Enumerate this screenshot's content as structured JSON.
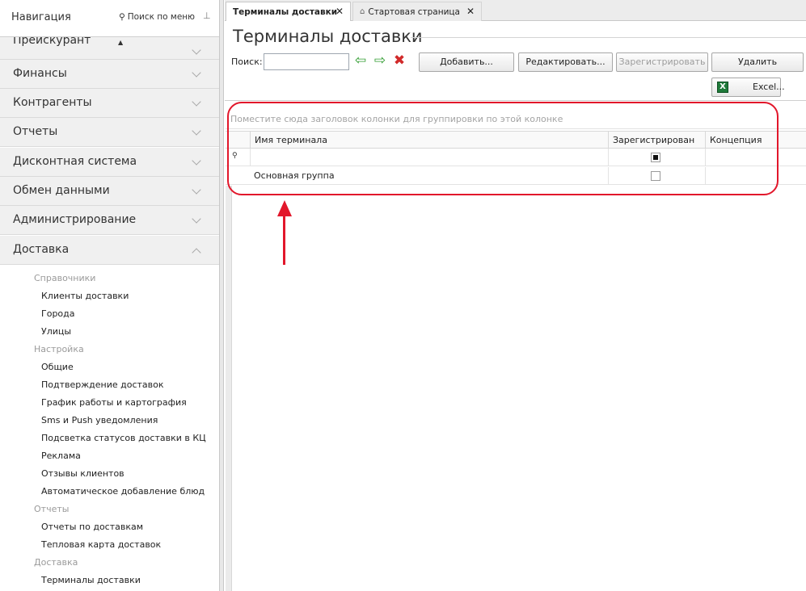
{
  "sidebar": {
    "title": "Навигация",
    "search_label": "Поиск по меню",
    "cut_section": "Прейскурант",
    "sections": [
      {
        "label": "Финансы",
        "expanded": false
      },
      {
        "label": "Контрагенты",
        "expanded": false
      },
      {
        "label": "Отчеты",
        "expanded": false
      },
      {
        "label": "Дисконтная система",
        "expanded": false
      },
      {
        "label": "Обмен данными",
        "expanded": false
      },
      {
        "label": "Администрирование",
        "expanded": false
      },
      {
        "label": "Доставка",
        "expanded": true
      }
    ],
    "delivery_items": [
      {
        "text": "Справочники",
        "kind": "group"
      },
      {
        "text": "Клиенты доставки",
        "kind": "item"
      },
      {
        "text": "Города",
        "kind": "item"
      },
      {
        "text": "Улицы",
        "kind": "item"
      },
      {
        "text": "Настройка",
        "kind": "group"
      },
      {
        "text": "Общие",
        "kind": "item"
      },
      {
        "text": "Подтверждение доставок",
        "kind": "item"
      },
      {
        "text": "График работы и картография",
        "kind": "item"
      },
      {
        "text": "Sms и Push уведомления",
        "kind": "item"
      },
      {
        "text": "Подсветка статусов доставки в КЦ",
        "kind": "item"
      },
      {
        "text": "Реклама",
        "kind": "item"
      },
      {
        "text": "Отзывы клиентов",
        "kind": "item"
      },
      {
        "text": "Автоматическое добавление блюд",
        "kind": "item"
      },
      {
        "text": "Отчеты",
        "kind": "group"
      },
      {
        "text": "Отчеты по доставкам",
        "kind": "item"
      },
      {
        "text": "Тепловая карта доставок",
        "kind": "item"
      },
      {
        "text": "Доставка",
        "kind": "group"
      },
      {
        "text": "Терминалы доставки",
        "kind": "item"
      }
    ]
  },
  "tabs": [
    {
      "label": "Терминалы доставки",
      "active": true
    },
    {
      "label": "Стартовая страница",
      "active": false
    }
  ],
  "page": {
    "title": "Терминалы доставки"
  },
  "toolbar": {
    "search_label": "Поиск:",
    "search_value": "",
    "add_label": "Добавить...",
    "edit_label": "Редактировать...",
    "register_label": "Зарегистрировать",
    "delete_label": "Удалить",
    "excel_label": "Excel..."
  },
  "grid": {
    "group_hint": "Поместите сюда заголовок колонки для группировки по этой колонке",
    "columns": [
      "Имя терминала",
      "Зарегистрирован",
      "Концепция"
    ],
    "filter_registered": true,
    "rows": [
      {
        "name": "Основная группа",
        "registered": false,
        "concept": ""
      }
    ]
  },
  "colors": {
    "highlight": "#e2172b",
    "accent_green": "#2e9b2e",
    "delete_red": "#d12a2a"
  }
}
